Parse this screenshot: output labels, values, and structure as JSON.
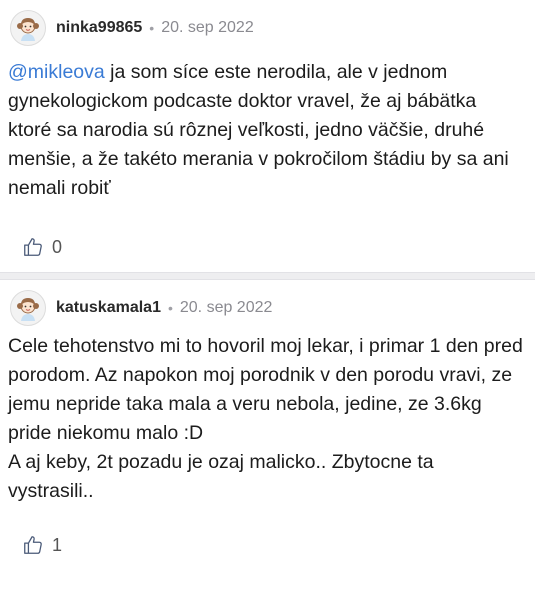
{
  "comments": [
    {
      "username": "ninka99865",
      "separator": "•",
      "date": "20. sep 2022",
      "mention": "@mikleova",
      "text": " ja som síce este nerodila, ale v jednom gynekologickom podcaste doktor vravel, že aj bábätka ktoré sa narodia sú rôznej veľkosti, jedno väčšie, druhé menšie, a že takéto merania v pokročilom štádiu by sa ani nemali robiť",
      "likes": "0",
      "avatar_icon": "girl-avatar-icon",
      "like_icon": "thumbs-up-icon"
    },
    {
      "username": "katuskamala1",
      "separator": "•",
      "date": "20. sep 2022",
      "text_lines": [
        "Cele tehotenstvo mi to hovoril moj lekar, i primar 1 den pred porodom. Az napokon moj porodnik v den porodu vravi, ze jemu nepride taka mala a veru nebola, jedine, ze 3.6kg pride niekomu malo :D",
        "A aj keby, 2t pozadu je ozaj malicko.. Zbytocne ta vystrasili.."
      ],
      "likes": "1",
      "avatar_icon": "girl-avatar-icon",
      "like_icon": "thumbs-up-icon"
    }
  ],
  "colors": {
    "mention": "#3a7bd5",
    "divider": "#eeeef0",
    "text": "#1c1c1c",
    "meta": "#8a8a90"
  }
}
